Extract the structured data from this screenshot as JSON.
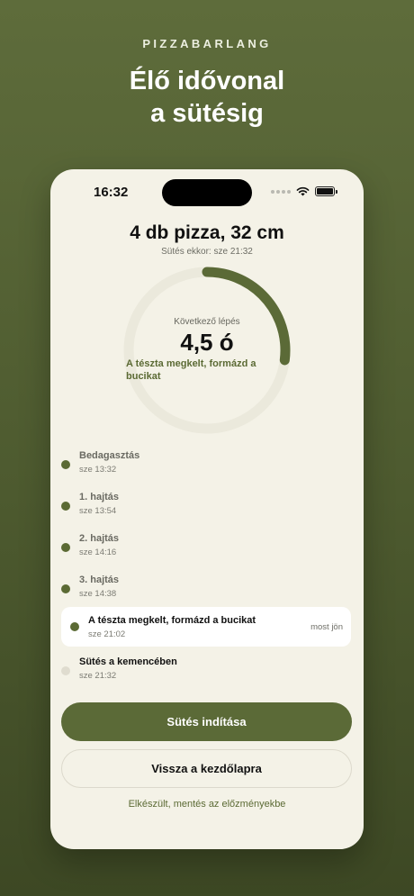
{
  "brand": "PIZZABARLANG",
  "headline": {
    "line1": "Élő idővonal",
    "line2": "a sütésig"
  },
  "status_bar": {
    "time": "16:32"
  },
  "order": {
    "title": "4 db pizza, 32 cm",
    "bake_at": "Sütés ekkor: sze 21:32"
  },
  "next_step": {
    "label": "Következő lépés",
    "value": "4,5 ó",
    "task": "A tészta megkelt, formázd a bucikat",
    "progress": 0.27
  },
  "timeline": [
    {
      "title": "Bedagasztás",
      "time": "sze 13:32",
      "state": "done"
    },
    {
      "title": "1. hajtás",
      "time": "sze 13:54",
      "state": "done"
    },
    {
      "title": "2. hajtás",
      "time": "sze 14:16",
      "state": "done"
    },
    {
      "title": "3. hajtás",
      "time": "sze 14:38",
      "state": "done"
    },
    {
      "title": "A tészta megkelt, formázd a bucikat",
      "time": "sze 21:02",
      "state": "current",
      "badge": "most jön"
    },
    {
      "title": "Sütés a kemencében",
      "time": "sze 21:32",
      "state": "pending"
    }
  ],
  "actions": {
    "start_label": "Sütés indítása",
    "back_label": "Vissza a kezdőlapra",
    "save_label": "Elkészült, mentés az előzményekbe"
  },
  "colors": {
    "accent": "#5b6a37",
    "background": "#4f5d31",
    "card": "#f4f2e7",
    "ring_track": "#ebe9dc"
  },
  "icons": {
    "signal": "signal-dots-icon",
    "wifi": "wifi-icon",
    "battery": "battery-icon"
  }
}
